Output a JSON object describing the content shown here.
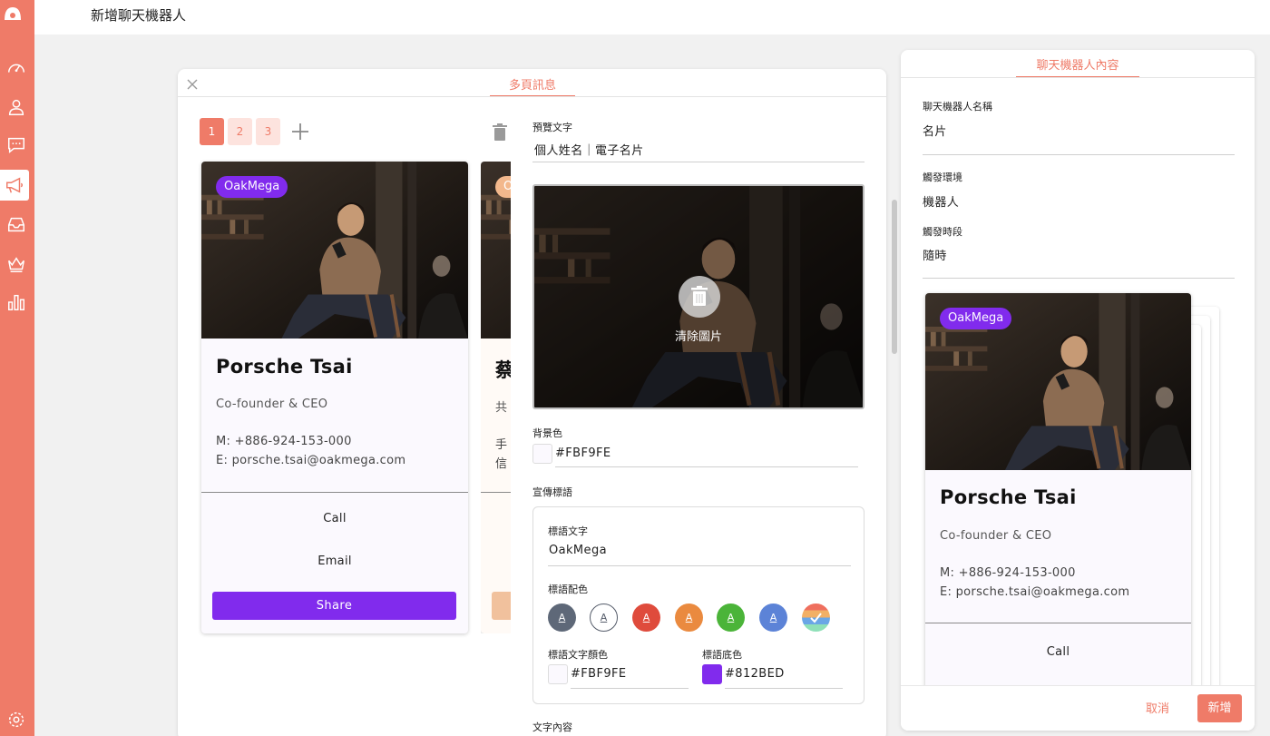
{
  "page": {
    "title": "新增聊天機器人"
  },
  "colors": {
    "brand": "#ef7b68",
    "card_bg": "#FBF9FE",
    "slogan_bg": "#812BED"
  },
  "sidebar": {
    "icons": [
      "logo-icon",
      "dashboard-icon",
      "user-icon",
      "chat-icon",
      "megaphone-icon",
      "inbox-icon",
      "crown-icon",
      "bar-chart-icon",
      "settings-icon"
    ],
    "active": "megaphone-icon"
  },
  "editor": {
    "tab": "多頁訊息",
    "pages": [
      "1",
      "2",
      "3"
    ],
    "active_page": "1"
  },
  "bubbles": [
    {
      "badge": "OakMega",
      "name": "Porsche Tsai",
      "role": "Co-founder & CEO",
      "mobile": "M: +886-924-153-000",
      "email": "E: porsche.tsai@oakmega.com",
      "call": "Call",
      "email_btn": "Email",
      "share": "Share"
    },
    {
      "badge": "O",
      "name": "蔡",
      "role": "共",
      "mobile": "手",
      "email": "信"
    }
  ],
  "form": {
    "preview_text_label": "預覽文字",
    "preview_text_value": "個人姓名｜電子名片",
    "clear_image": "清除圖片",
    "bg_color_label": "背景色",
    "bg_color_value": "#FBF9FE",
    "slogan_section": "宣傳標語",
    "slogan_text_label": "標語文字",
    "slogan_text_value": "OakMega",
    "slogan_palette_label": "標語配色",
    "palette": [
      {
        "bg": "#5e6878",
        "fg": "#ffffff",
        "glyph": "A"
      },
      {
        "bg": "#ffffff",
        "fg": "#555c6a",
        "glyph": "A"
      },
      {
        "bg": "#df4b3c",
        "fg": "#ffffff",
        "glyph": "A"
      },
      {
        "bg": "#ea8a3f",
        "fg": "#ffffff",
        "glyph": "A"
      },
      {
        "bg": "#4bb439",
        "fg": "#ffffff",
        "glyph": "A"
      },
      {
        "bg": "#5c83d7",
        "fg": "#ffffff",
        "glyph": "A"
      }
    ],
    "slogan_text_color_label": "標語文字顏色",
    "slogan_text_color_value": "#FBF9FE",
    "slogan_bg_label": "標語底色",
    "slogan_bg_value": "#812BED",
    "text_content_label": "文字內容"
  },
  "preview": {
    "tab": "聊天機器人內容",
    "name_label": "聊天機器人名稱",
    "name_value": "名片",
    "env_label": "觸發環境",
    "env_value": "機器人",
    "period_label": "觸發時段",
    "period_value": "隨時",
    "cancel": "取消",
    "submit": "新增"
  }
}
